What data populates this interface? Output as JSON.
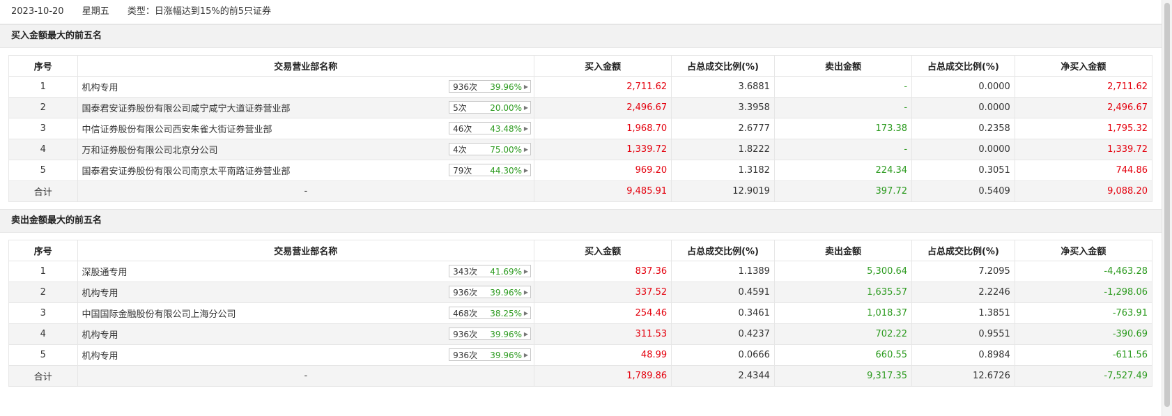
{
  "header": {
    "date": "2023-10-20",
    "weekday": "星期五",
    "type_label": "类型：日涨幅达到15%的前5只证券"
  },
  "columns": [
    "序号",
    "交易营业部名称",
    "买入金额",
    "占总成交比例(%)",
    "卖出金额",
    "占总成交比例(%)",
    "净买入金额"
  ],
  "buy_section": {
    "title": "买入金额最大的前五名",
    "rows": [
      {
        "no": "1",
        "name": "机构专用",
        "times": "936次",
        "rate": "39.96%",
        "buy": "2,711.62",
        "buy_pct": "3.6881",
        "sell": "-",
        "sell_pct": "0.0000",
        "net": "2,711.62"
      },
      {
        "no": "2",
        "name": "国泰君安证券股份有限公司咸宁咸宁大道证券营业部",
        "times": "5次",
        "rate": "20.00%",
        "buy": "2,496.67",
        "buy_pct": "3.3958",
        "sell": "-",
        "sell_pct": "0.0000",
        "net": "2,496.67"
      },
      {
        "no": "3",
        "name": "中信证券股份有限公司西安朱雀大街证券营业部",
        "times": "46次",
        "rate": "43.48%",
        "buy": "1,968.70",
        "buy_pct": "2.6777",
        "sell": "173.38",
        "sell_pct": "0.2358",
        "net": "1,795.32"
      },
      {
        "no": "4",
        "name": "万和证券股份有限公司北京分公司",
        "times": "4次",
        "rate": "75.00%",
        "buy": "1,339.72",
        "buy_pct": "1.8222",
        "sell": "-",
        "sell_pct": "0.0000",
        "net": "1,339.72"
      },
      {
        "no": "5",
        "name": "国泰君安证券股份有限公司南京太平南路证券营业部",
        "times": "79次",
        "rate": "44.30%",
        "buy": "969.20",
        "buy_pct": "1.3182",
        "sell": "224.34",
        "sell_pct": "0.3051",
        "net": "744.86"
      }
    ],
    "total": {
      "label": "合计",
      "name": "-",
      "buy": "9,485.91",
      "buy_pct": "12.9019",
      "sell": "397.72",
      "sell_pct": "0.5409",
      "net": "9,088.20"
    }
  },
  "sell_section": {
    "title": "卖出金额最大的前五名",
    "rows": [
      {
        "no": "1",
        "name": "深股通专用",
        "times": "343次",
        "rate": "41.69%",
        "buy": "837.36",
        "buy_pct": "1.1389",
        "sell": "5,300.64",
        "sell_pct": "7.2095",
        "net": "-4,463.28"
      },
      {
        "no": "2",
        "name": "机构专用",
        "times": "936次",
        "rate": "39.96%",
        "buy": "337.52",
        "buy_pct": "0.4591",
        "sell": "1,635.57",
        "sell_pct": "2.2246",
        "net": "-1,298.06"
      },
      {
        "no": "3",
        "name": "中国国际金融股份有限公司上海分公司",
        "times": "468次",
        "rate": "38.25%",
        "buy": "254.46",
        "buy_pct": "0.3461",
        "sell": "1,018.37",
        "sell_pct": "1.3851",
        "net": "-763.91"
      },
      {
        "no": "4",
        "name": "机构专用",
        "times": "936次",
        "rate": "39.96%",
        "buy": "311.53",
        "buy_pct": "0.4237",
        "sell": "702.22",
        "sell_pct": "0.9551",
        "net": "-390.69"
      },
      {
        "no": "5",
        "name": "机构专用",
        "times": "936次",
        "rate": "39.96%",
        "buy": "48.99",
        "buy_pct": "0.0666",
        "sell": "660.55",
        "sell_pct": "0.8984",
        "net": "-611.56"
      }
    ],
    "total": {
      "label": "合计",
      "name": "-",
      "buy": "1,789.86",
      "buy_pct": "2.4344",
      "sell": "9,317.35",
      "sell_pct": "12.6726",
      "net": "-7,527.49"
    }
  },
  "colors": {
    "up": "#e4000d",
    "down": "#2b9a1e"
  }
}
